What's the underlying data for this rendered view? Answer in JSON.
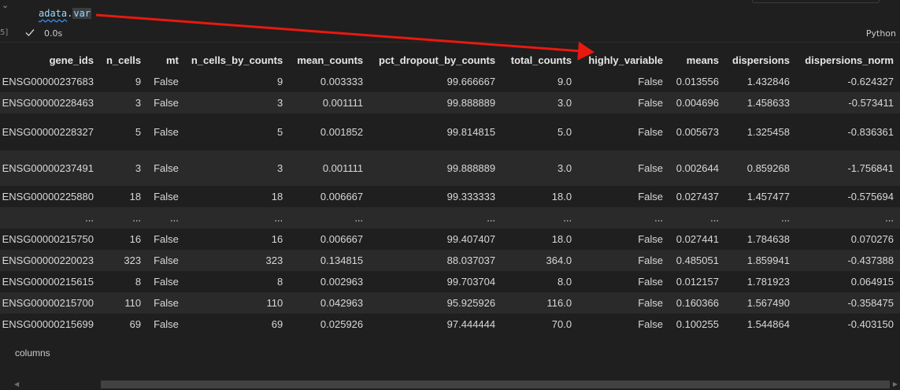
{
  "cell": {
    "code_var": "adata",
    "code_dot": ".",
    "code_attr": "var",
    "exec_count": "5]",
    "exec_time": "0.0s",
    "language": "Python",
    "chevron_icon": "chevron-down-icon",
    "status_icon": "check-icon"
  },
  "table": {
    "columns": [
      "gene_ids",
      "n_cells",
      "mt",
      "n_cells_by_counts",
      "mean_counts",
      "pct_dropout_by_counts",
      "total_counts",
      "highly_variable",
      "means",
      "dispersions",
      "dispersions_norm"
    ],
    "rows": [
      [
        "ENSG00000237683",
        "9",
        "False",
        "9",
        "0.003333",
        "99.666667",
        "9.0",
        "False",
        "0.013556",
        "1.432846",
        "-0.624327"
      ],
      [
        "ENSG00000228463",
        "3",
        "False",
        "3",
        "0.001111",
        "99.888889",
        "3.0",
        "False",
        "0.004696",
        "1.458633",
        "-0.573411"
      ],
      [
        "ENSG00000228327",
        "5",
        "False",
        "5",
        "0.001852",
        "99.814815",
        "5.0",
        "False",
        "0.005673",
        "1.325458",
        "-0.836361"
      ],
      [
        "ENSG00000237491",
        "3",
        "False",
        "3",
        "0.001111",
        "99.888889",
        "3.0",
        "False",
        "0.002644",
        "0.859268",
        "-1.756841"
      ],
      [
        "ENSG00000225880",
        "18",
        "False",
        "18",
        "0.006667",
        "99.333333",
        "18.0",
        "False",
        "0.027437",
        "1.457477",
        "-0.575694"
      ],
      [
        "...",
        "...",
        "...",
        "...",
        "...",
        "...",
        "...",
        "...",
        "...",
        "...",
        "..."
      ],
      [
        "ENSG00000215750",
        "16",
        "False",
        "16",
        "0.006667",
        "99.407407",
        "18.0",
        "False",
        "0.027441",
        "1.784638",
        "0.070276"
      ],
      [
        "ENSG00000220023",
        "323",
        "False",
        "323",
        "0.134815",
        "88.037037",
        "364.0",
        "False",
        "0.485051",
        "1.859941",
        "-0.437388"
      ],
      [
        "ENSG00000215615",
        "8",
        "False",
        "8",
        "0.002963",
        "99.703704",
        "8.0",
        "False",
        "0.012157",
        "1.781923",
        "0.064915"
      ],
      [
        "ENSG00000215700",
        "110",
        "False",
        "110",
        "0.042963",
        "95.925926",
        "116.0",
        "False",
        "0.160366",
        "1.567490",
        "-0.358475"
      ],
      [
        "ENSG00000215699",
        "69",
        "False",
        "69",
        "0.025926",
        "97.444444",
        "70.0",
        "False",
        "0.100255",
        "1.544864",
        "-0.403150"
      ]
    ]
  },
  "footer": {
    "columns_label": "columns"
  },
  "colors": {
    "background": "#1f1f1f",
    "stripe": "#2a2a2a",
    "annotation_arrow": "#e8190f"
  }
}
